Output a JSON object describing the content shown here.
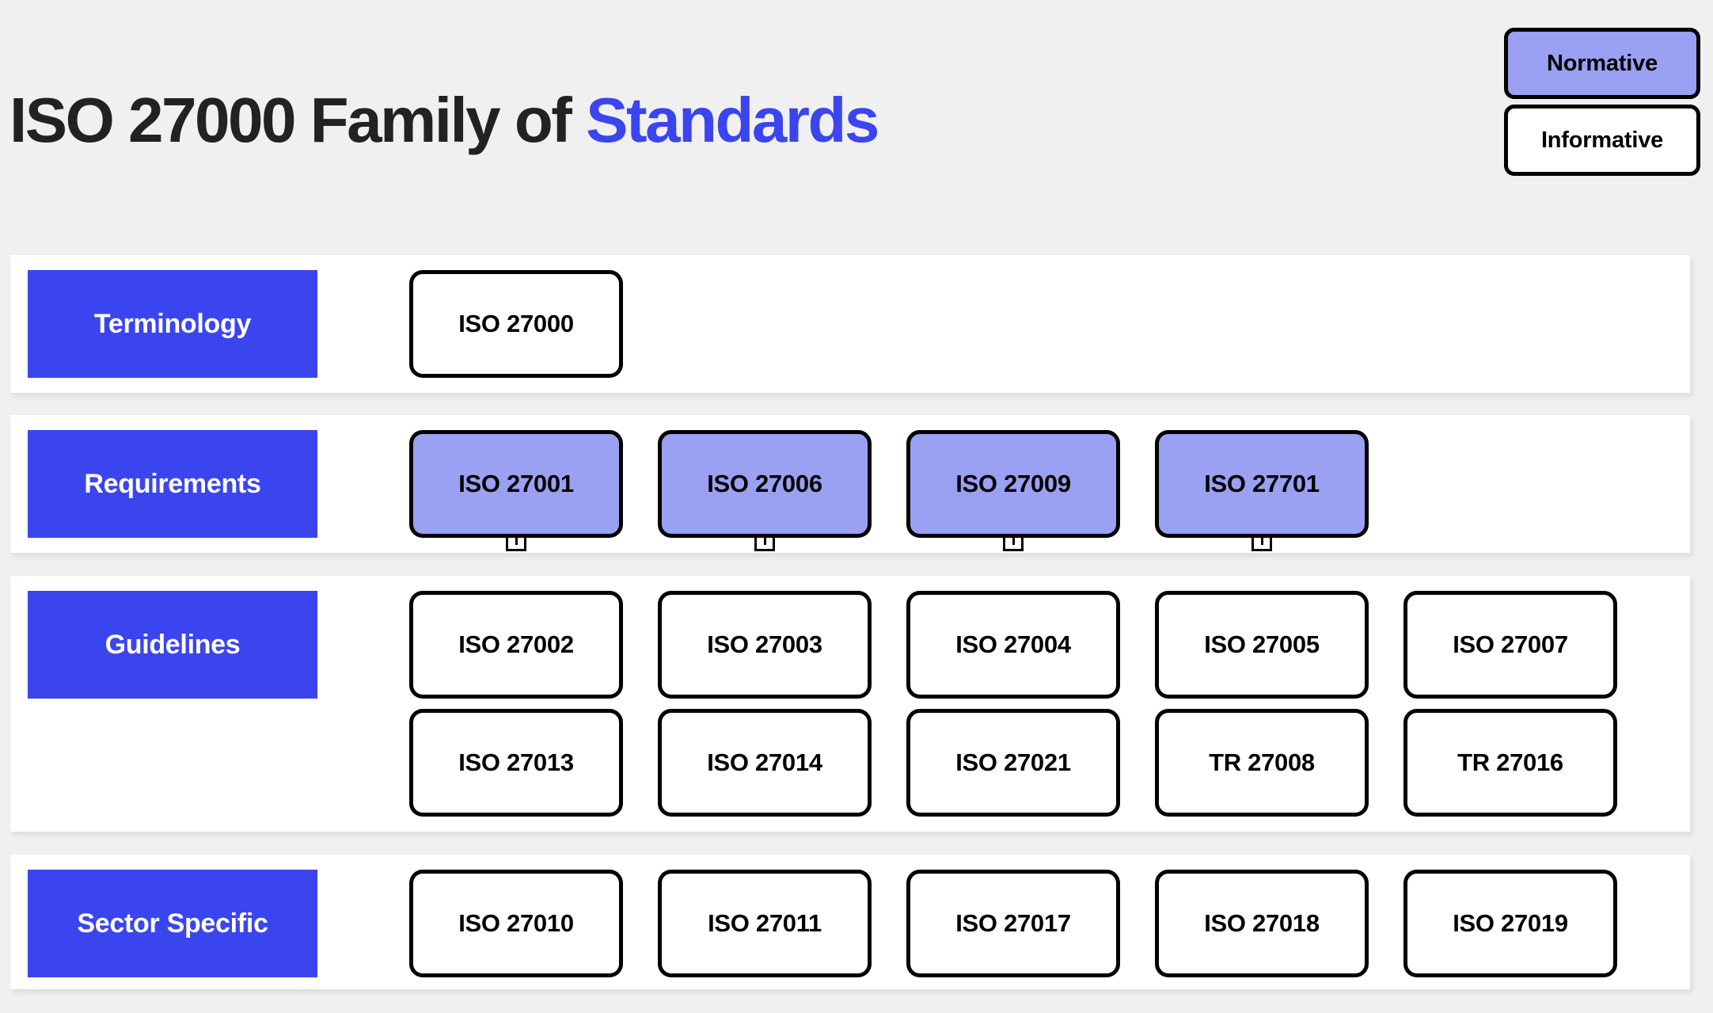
{
  "header": {
    "title_main": "ISO 27000 Family of ",
    "title_accent": "Standards"
  },
  "legend": {
    "items": [
      {
        "label": "Normative",
        "style": "normative",
        "fill": "#9aa0f2"
      },
      {
        "label": "Informative",
        "style": "informative",
        "fill": "#ffffff"
      }
    ]
  },
  "colors": {
    "brand_blue": "#3b45ef",
    "normative_fill": "#9aa0f2",
    "page_background": "#f0f0f0",
    "row_background": "#ffffff",
    "border": "#000000",
    "title_text": "#222222"
  },
  "rows": [
    {
      "id": "terminology",
      "label": "Terminology",
      "lines": [
        [
          {
            "label": "ISO 27000",
            "type": "informative",
            "stub": false
          }
        ]
      ]
    },
    {
      "id": "requirements",
      "label": "Requirements",
      "lines": [
        [
          {
            "label": "ISO 27001",
            "type": "normative",
            "stub": true
          },
          {
            "label": "ISO 27006",
            "type": "normative",
            "stub": true
          },
          {
            "label": "ISO 27009",
            "type": "normative",
            "stub": true
          },
          {
            "label": "ISO 27701",
            "type": "normative",
            "stub": true
          }
        ]
      ]
    },
    {
      "id": "guidelines",
      "label": "Guidelines",
      "lines": [
        [
          {
            "label": "ISO 27002",
            "type": "informative",
            "stub": false
          },
          {
            "label": "ISO 27003",
            "type": "informative",
            "stub": false
          },
          {
            "label": "ISO 27004",
            "type": "informative",
            "stub": false
          },
          {
            "label": "ISO 27005",
            "type": "informative",
            "stub": false
          },
          {
            "label": "ISO 27007",
            "type": "informative",
            "stub": false
          }
        ],
        [
          {
            "label": "ISO 27013",
            "type": "informative",
            "stub": false
          },
          {
            "label": "ISO 27014",
            "type": "informative",
            "stub": false
          },
          {
            "label": "ISO 27021",
            "type": "informative",
            "stub": false
          },
          {
            "label": "TR 27008",
            "type": "informative",
            "stub": false
          },
          {
            "label": "TR 27016",
            "type": "informative",
            "stub": false
          }
        ]
      ]
    },
    {
      "id": "sector",
      "label": "Sector Specific",
      "lines": [
        [
          {
            "label": "ISO 27010",
            "type": "informative",
            "stub": false
          },
          {
            "label": "ISO 27011",
            "type": "informative",
            "stub": false
          },
          {
            "label": "ISO 27017",
            "type": "informative",
            "stub": false
          },
          {
            "label": "ISO 27018",
            "type": "informative",
            "stub": false
          },
          {
            "label": "ISO 27019",
            "type": "informative",
            "stub": false
          }
        ]
      ]
    }
  ]
}
